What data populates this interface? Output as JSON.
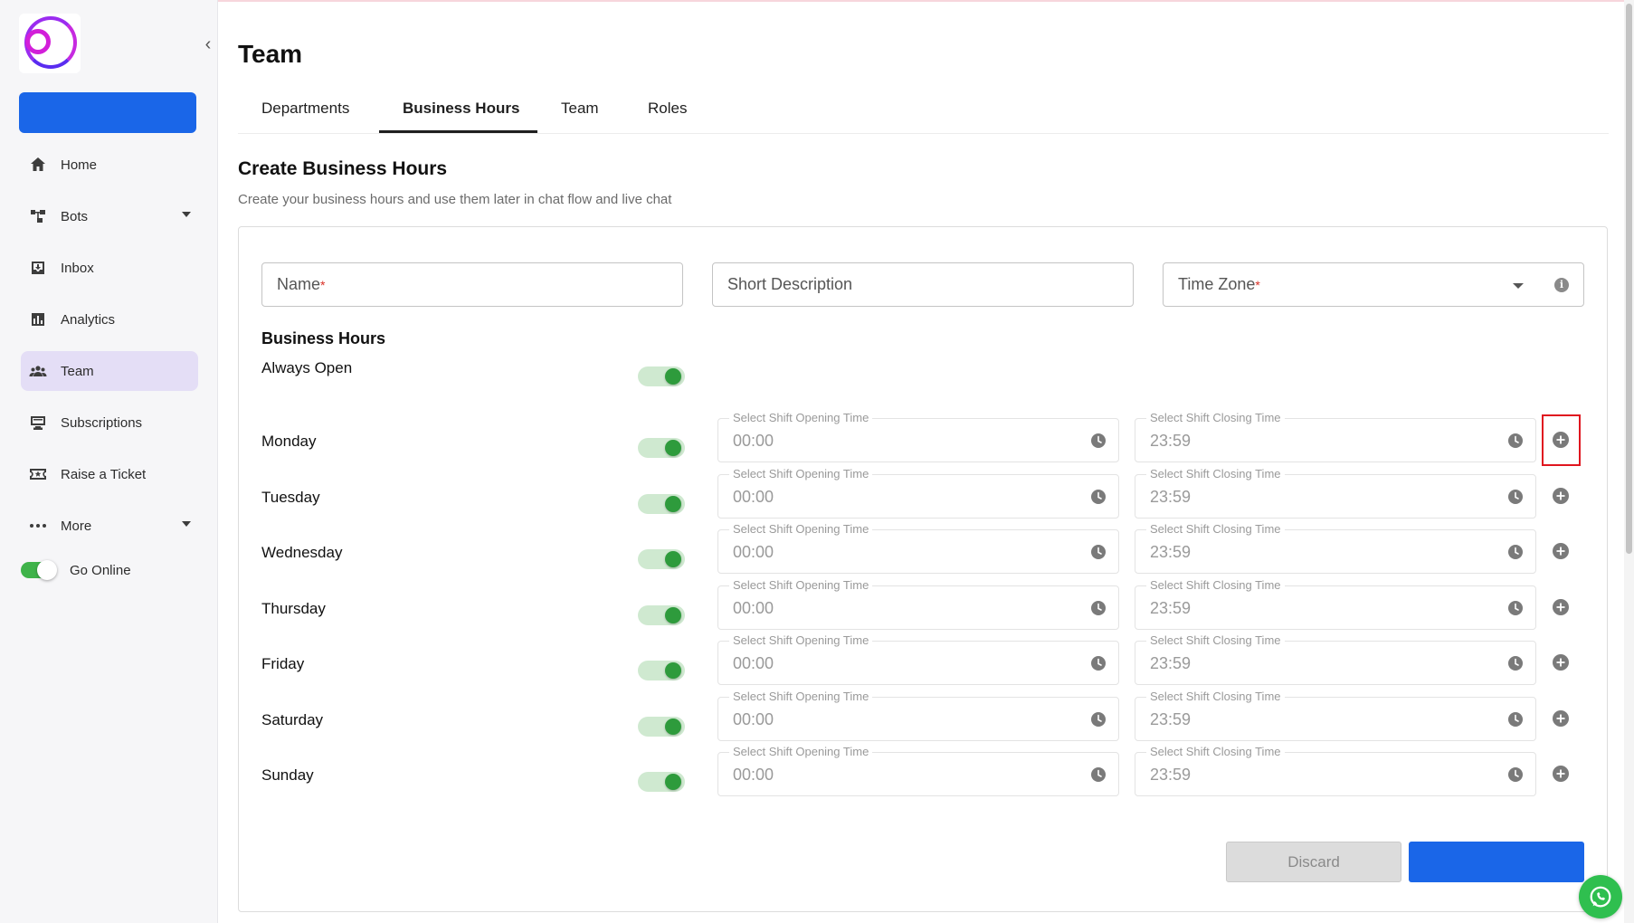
{
  "sidebar": {
    "items": [
      {
        "label": "Home",
        "icon": "home-icon"
      },
      {
        "label": "Bots",
        "icon": "bots-icon",
        "has_caret": true
      },
      {
        "label": "Inbox",
        "icon": "inbox-icon"
      },
      {
        "label": "Analytics",
        "icon": "analytics-icon"
      },
      {
        "label": "Team",
        "icon": "team-icon",
        "active": true
      },
      {
        "label": "Subscriptions",
        "icon": "subscriptions-icon"
      },
      {
        "label": "Raise a Ticket",
        "icon": "ticket-icon"
      },
      {
        "label": "More",
        "icon": "more-icon",
        "has_caret": true
      }
    ],
    "go_online_label": "Go Online",
    "go_online_on": true
  },
  "header": {
    "title": "Team"
  },
  "tabs": [
    {
      "label": "Departments"
    },
    {
      "label": "Business Hours",
      "active": true
    },
    {
      "label": "Team"
    },
    {
      "label": "Roles"
    }
  ],
  "form": {
    "title": "Create Business Hours",
    "subtitle": "Create your business hours and use them later in chat flow and live chat",
    "name_placeholder": "Name",
    "description_placeholder": "Short Description",
    "timezone_placeholder": "Time Zone",
    "required_mark": "*",
    "business_hours_heading": "Business Hours",
    "always_open_label": "Always Open",
    "always_open_on": true,
    "opening_label": "Select Shift Opening Time",
    "closing_label": "Select Shift Closing Time",
    "days": [
      {
        "name": "Monday",
        "enabled": true,
        "open": "00:00",
        "close": "23:59"
      },
      {
        "name": "Tuesday",
        "enabled": true,
        "open": "00:00",
        "close": "23:59"
      },
      {
        "name": "Wednesday",
        "enabled": true,
        "open": "00:00",
        "close": "23:59"
      },
      {
        "name": "Thursday",
        "enabled": true,
        "open": "00:00",
        "close": "23:59"
      },
      {
        "name": "Friday",
        "enabled": true,
        "open": "00:00",
        "close": "23:59"
      },
      {
        "name": "Saturday",
        "enabled": true,
        "open": "00:00",
        "close": "23:59"
      },
      {
        "name": "Sunday",
        "enabled": true,
        "open": "00:00",
        "close": "23:59"
      }
    ],
    "discard_label": "Discard",
    "save_label": ""
  },
  "colors": {
    "primary": "#1a66e8",
    "toggle_on": "#2e9b3c",
    "active_nav_bg": "#e4def6",
    "highlight": "#e0161f",
    "whatsapp": "#2fbf4f"
  }
}
